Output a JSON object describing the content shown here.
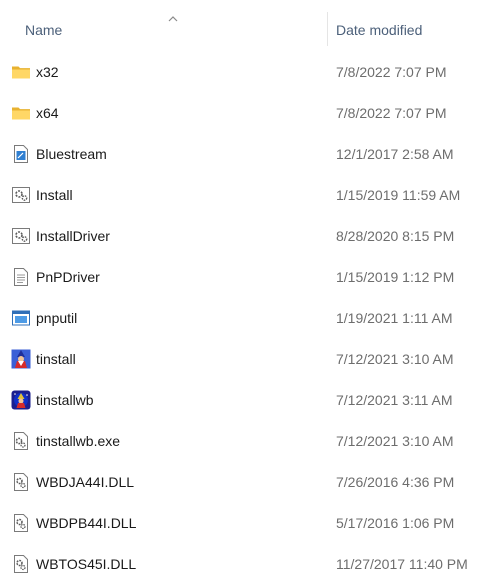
{
  "columns": {
    "name": "Name",
    "date_modified": "Date modified"
  },
  "files": [
    {
      "name": "x32",
      "date": "7/8/2022 7:07 PM",
      "icon": "folder-icon"
    },
    {
      "name": "x64",
      "date": "7/8/2022 7:07 PM",
      "icon": "folder-icon"
    },
    {
      "name": "Bluestream",
      "date": "12/1/2017 2:58 AM",
      "icon": "document-blue-icon"
    },
    {
      "name": "Install",
      "date": "1/15/2019 11:59 AM",
      "icon": "settings-file-icon"
    },
    {
      "name": "InstallDriver",
      "date": "8/28/2020 8:15 PM",
      "icon": "settings-file-icon"
    },
    {
      "name": "PnPDriver",
      "date": "1/15/2019 1:12 PM",
      "icon": "text-file-icon"
    },
    {
      "name": "pnputil",
      "date": "1/19/2021 1:11 AM",
      "icon": "application-window-icon"
    },
    {
      "name": "tinstall",
      "date": "7/12/2021 3:10 AM",
      "icon": "wizard-app-icon"
    },
    {
      "name": "tinstallwb",
      "date": "7/12/2021 3:11 AM",
      "icon": "wizard-night-app-icon"
    },
    {
      "name": "tinstallwb.exe",
      "date": "7/12/2021 3:10 AM",
      "icon": "exe-config-file-icon"
    },
    {
      "name": "WBDJA44I.DLL",
      "date": "7/26/2016 4:36 PM",
      "icon": "dll-file-icon"
    },
    {
      "name": "WBDPB44I.DLL",
      "date": "5/17/2016 1:06 PM",
      "icon": "dll-file-icon"
    },
    {
      "name": "WBTOS45I.DLL",
      "date": "11/27/2017 11:40 PM",
      "icon": "dll-file-icon"
    }
  ]
}
